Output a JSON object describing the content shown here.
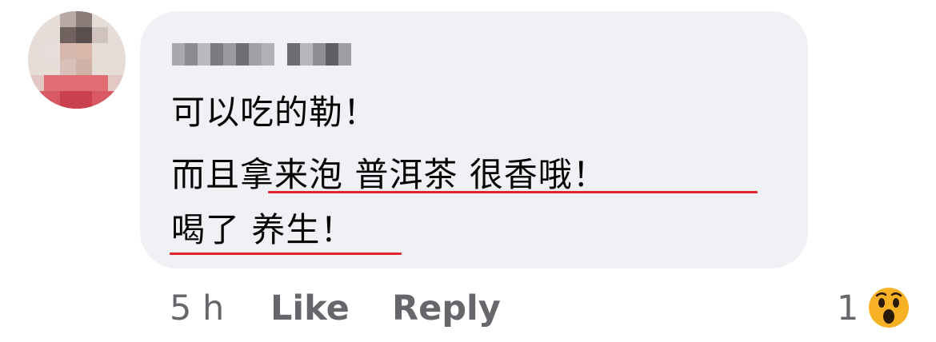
{
  "comment": {
    "author_name": "",
    "lines": [
      "可以吃的勒！",
      "而且拿来泡 普洱茶 很香哦！",
      "喝了 养生！"
    ],
    "timestamp": "5 h",
    "like_label": "Like",
    "reply_label": "Reply",
    "reaction_count": "1",
    "reaction_icon": "wow-emoji-icon"
  },
  "colors": {
    "bubble": "#f0f1f5",
    "text": "#050505",
    "meta": "#65676b",
    "spellcheck_underline": "#e0242c",
    "reaction_face": "#f7b125"
  }
}
